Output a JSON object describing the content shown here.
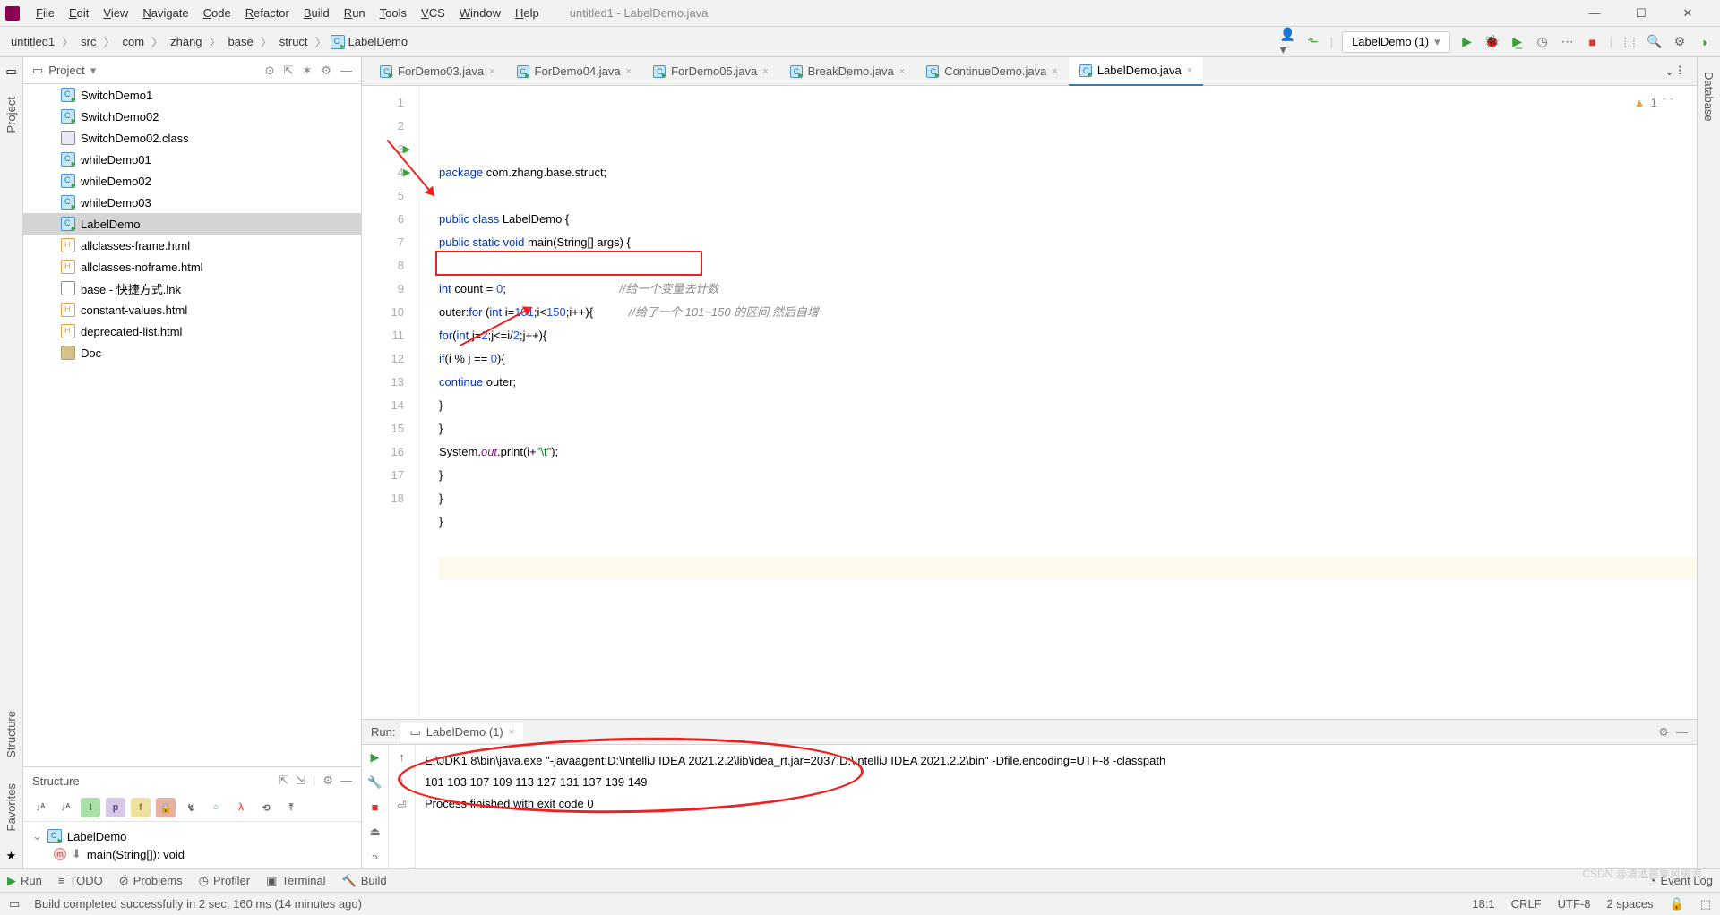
{
  "menu": [
    "File",
    "Edit",
    "View",
    "Navigate",
    "Code",
    "Refactor",
    "Build",
    "Run",
    "Tools",
    "VCS",
    "Window",
    "Help"
  ],
  "title": "untitled1 - LabelDemo.java",
  "breadcrumb": [
    "untitled1",
    "src",
    "com",
    "zhang",
    "base",
    "struct"
  ],
  "breadcrumb_file": "LabelDemo",
  "run_config": "LabelDemo (1)",
  "project_label": "Project",
  "tree": [
    {
      "name": "SwitchDemo1",
      "icon": "java"
    },
    {
      "name": "SwitchDemo02",
      "icon": "java"
    },
    {
      "name": "SwitchDemo02.class",
      "icon": "class"
    },
    {
      "name": "whileDemo01",
      "icon": "java"
    },
    {
      "name": "whileDemo02",
      "icon": "java"
    },
    {
      "name": "whileDemo03",
      "icon": "java"
    },
    {
      "name": "LabelDemo",
      "icon": "java",
      "selected": true
    },
    {
      "name": "allclasses-frame.html",
      "icon": "html"
    },
    {
      "name": "allclasses-noframe.html",
      "icon": "html"
    },
    {
      "name": "base - 快捷方式.lnk",
      "icon": "lnk"
    },
    {
      "name": "constant-values.html",
      "icon": "html"
    },
    {
      "name": "deprecated-list.html",
      "icon": "html"
    },
    {
      "name": "Doc",
      "icon": "folder"
    }
  ],
  "structure_label": "Structure",
  "structure_root": "LabelDemo",
  "structure_method": "main(String[]): void",
  "tabs": [
    "ForDemo03.java",
    "ForDemo04.java",
    "ForDemo05.java",
    "BreakDemo.java",
    "ContinueDemo.java",
    "LabelDemo.java"
  ],
  "active_tab": 5,
  "warn_count": "1",
  "code_lines": [
    {
      "n": 1,
      "html": "<span class='kw'>package</span> com.zhang.base.struct;"
    },
    {
      "n": 2,
      "html": ""
    },
    {
      "n": 3,
      "html": "<span class='kw'>public class</span> LabelDemo {",
      "run": true
    },
    {
      "n": 4,
      "html": "<span class='kw'>public static void</span> main(String[] args) {",
      "run": true
    },
    {
      "n": 5,
      "html": ""
    },
    {
      "n": 6,
      "html": "<span class='kw'>int</span> count = <span class='num'>0</span>;                                   <span class='cmt'>//给一个变量去计数</span>"
    },
    {
      "n": 7,
      "html": "outer:<span class='kw'>for</span> (<span class='kw'>int</span> i=<span class='num'>101</span>;i&lt;<span class='num'>150</span>;i++){           <span class='cmt'>//给了一个 101~150 的区间,然后自增</span>"
    },
    {
      "n": 8,
      "html": "<span class='kw'>for</span>(<span class='kw'>int</span> j=<span class='num'>2</span>;j&lt;=i/<span class='num'>2</span>;j++){"
    },
    {
      "n": 9,
      "html": "<span class='kw'>if</span>(i % j == <span class='num'>0</span>){"
    },
    {
      "n": 10,
      "html": "<span class='kw'>continue</span> outer;"
    },
    {
      "n": 11,
      "html": "}"
    },
    {
      "n": 12,
      "html": "}"
    },
    {
      "n": 13,
      "html": "System.<span class='field'>out</span>.print(i+<span class='str'>\"\\t\"</span>);"
    },
    {
      "n": 14,
      "html": "}"
    },
    {
      "n": 15,
      "html": "}"
    },
    {
      "n": 16,
      "html": "}"
    },
    {
      "n": 17,
      "html": ""
    },
    {
      "n": 18,
      "html": "",
      "caret": true
    }
  ],
  "run_label": "Run:",
  "run_tab": "LabelDemo (1)",
  "console": [
    "E:\\JDK1.8\\bin\\java.exe \"-javaagent:D:\\IntelliJ IDEA 2021.2.2\\lib\\idea_rt.jar=2037:D:\\IntelliJ IDEA 2021.2.2\\bin\" -Dfile.encoding=UTF-8 -classpath",
    "101 103 107 109 113 127 131 137 139 149",
    "Process finished with exit code 0"
  ],
  "tool_strip": {
    "run": "Run",
    "todo": "TODO",
    "problems": "Problems",
    "profiler": "Profiler",
    "terminal": "Terminal",
    "build": "Build",
    "eventlog": "Event Log"
  },
  "status_msg": "Build completed successfully in 2 sec, 160 ms (14 minutes ago)",
  "status_right": {
    "pos": "18:1",
    "sep": "CRLF",
    "enc": "UTF-8",
    "indent": "2 spaces"
  },
  "watermark": "CSDN @清池酱乘风破浪",
  "side_left": {
    "project": "Project",
    "structure": "Structure",
    "favorites": "Favorites"
  },
  "side_right": "Database"
}
